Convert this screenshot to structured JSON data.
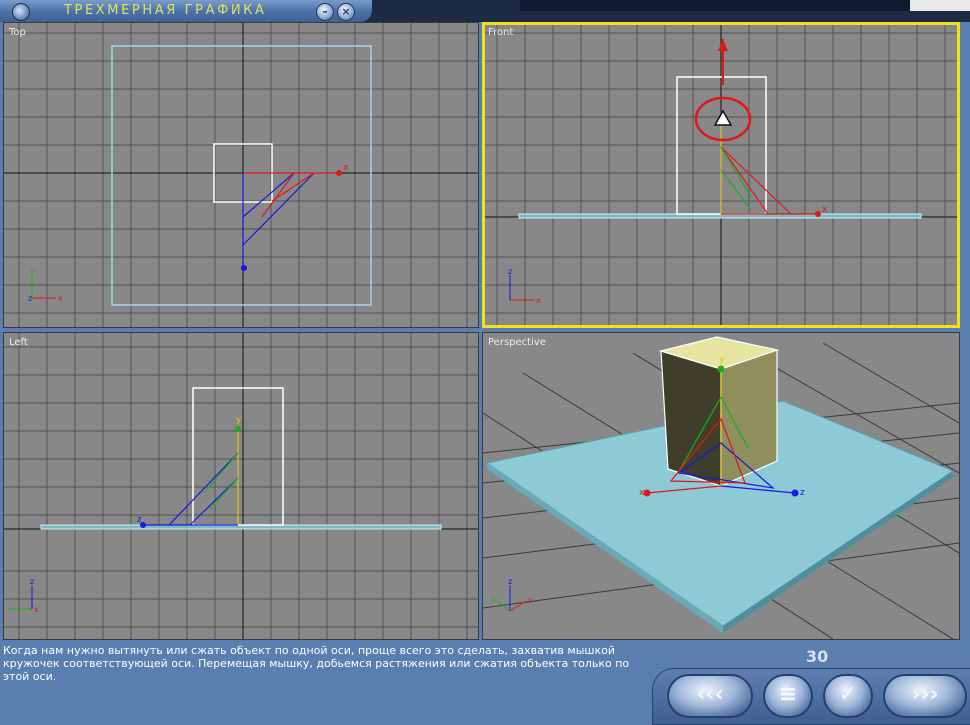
{
  "window": {
    "title": "ТРЕХМЕРНАЯ ГРАФИКА",
    "minimize_icon": "minimize-icon",
    "close_icon": "close-icon"
  },
  "viewports": {
    "top": {
      "label": "Top"
    },
    "front": {
      "label": "Front"
    },
    "left": {
      "label": "Left"
    },
    "perspective": {
      "label": "Perspective"
    }
  },
  "axis_labels": {
    "x": "x",
    "y": "y",
    "z": "z"
  },
  "description": "Когда нам нужно вытянуть или сжать объект по одной оси, проще всего это сделать, захватив мышкой кружочек соответствующей оси. Перемещая мышку, добьемся растяжения или сжатия объекта только по этой оси.",
  "page_number": "30",
  "nav": {
    "back_label": "‹‹‹",
    "contents_label": "≡",
    "check_label": "✓",
    "forward_label": "›››"
  },
  "colors": {
    "active_viewport": "#f2e01a",
    "x_axis": "#e01818",
    "y_axis": "#18b018",
    "z_axis": "#1818e0",
    "highlight_circle": "#e01818"
  }
}
